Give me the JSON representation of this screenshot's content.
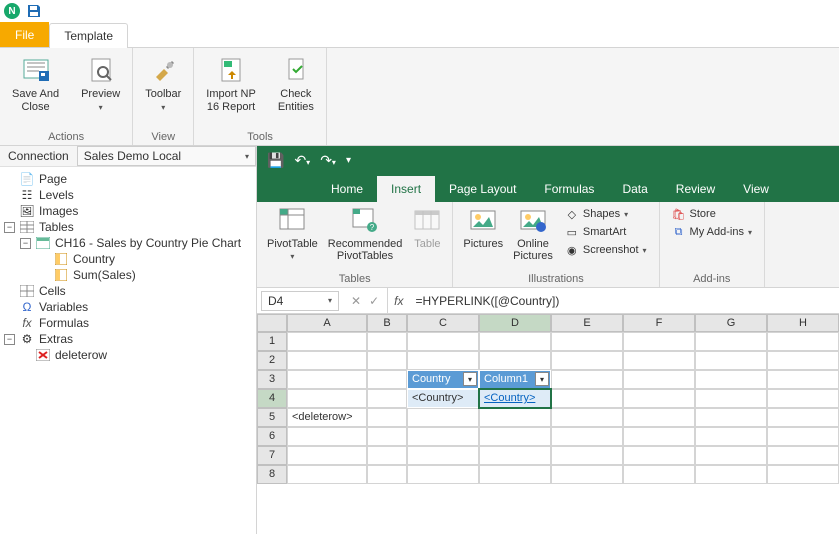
{
  "titlebar": {
    "app_badge": "N"
  },
  "ribbon": {
    "tabs": {
      "file": "File",
      "template": "Template"
    },
    "actions": {
      "save_close": "Save And\nClose",
      "preview": "Preview",
      "group_label": "Actions"
    },
    "tools": {
      "toolbar": "Toolbar",
      "import": "Import NP\n16 Report",
      "check": "Check\nEntities",
      "group_label": "Tools",
      "view_label": "View"
    }
  },
  "connection": {
    "label": "Connection",
    "value": "Sales Demo Local"
  },
  "tree": {
    "page": "Page",
    "levels": "Levels",
    "images": "Images",
    "tables": "Tables",
    "chart": "CH16 - Sales by Country Pie Chart",
    "country": "Country",
    "sum_sales": "Sum(Sales)",
    "cells": "Cells",
    "variables": "Variables",
    "formulas": "Formulas",
    "extras": "Extras",
    "deleterow": "deleterow"
  },
  "excel": {
    "tabs": {
      "home": "Home",
      "insert": "Insert",
      "page_layout": "Page Layout",
      "formulas": "Formulas",
      "data": "Data",
      "review": "Review",
      "view": "View"
    },
    "groups": {
      "tables": {
        "pivot": "PivotTable",
        "recommended": "Recommended\nPivotTables",
        "table": "Table",
        "label": "Tables"
      },
      "illustrations": {
        "pictures": "Pictures",
        "online_pictures": "Online\nPictures",
        "shapes": "Shapes",
        "smartart": "SmartArt",
        "screenshot": "Screenshot",
        "label": "Illustrations"
      },
      "addins": {
        "store": "Store",
        "my_addins": "My Add-ins",
        "label": "Add-ins"
      }
    },
    "namebox": "D4",
    "fx_label": "fx",
    "formula": "=HYPERLINK([@Country])",
    "columns": [
      "A",
      "B",
      "C",
      "D",
      "E",
      "F",
      "G",
      "H"
    ],
    "rows": [
      "1",
      "2",
      "3",
      "4",
      "5",
      "6",
      "7",
      "8"
    ],
    "table_headers": {
      "c3": "Country",
      "d3": "Column1"
    },
    "table_body": {
      "c4": "<Country>",
      "d4": "<Country>"
    },
    "a5": "<deleterow>"
  }
}
